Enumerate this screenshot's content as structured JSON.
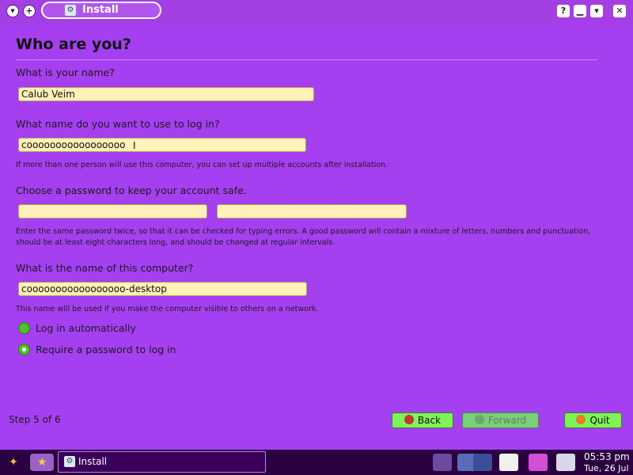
{
  "window": {
    "title": "Install"
  },
  "page": {
    "heading": "Who are you?",
    "name_label": "What is your name?",
    "name_value": "Calub Veim",
    "login_label": "What name do you want to use to log in?",
    "login_value": "cooooooooooooooooo",
    "login_note": "If more than one person will use this computer, you can set up multiple accounts after installation.",
    "password_label": "Choose a password to keep your account safe.",
    "password_value": "",
    "password_confirm_value": "",
    "password_note_1": "Enter the same password twice, so that it can be checked for typing errors. A good password will contain a mixture of letters, numbers and punctuation,",
    "password_note_2": "should be at least eight characters long, and should be changed at regular intervals.",
    "computer_label": "What is the name of this computer?",
    "computer_value": "cooooooooooooooooo-desktop",
    "computer_note": "This name will be used if you make the computer visible to others on a network.",
    "options": [
      {
        "label": "Log in automatically",
        "selected": false
      },
      {
        "label": "Require a password to log in",
        "selected": true
      }
    ]
  },
  "footer": {
    "step": "Step 5 of 6",
    "back": "Back",
    "forward": "Forward",
    "quit": "Quit"
  },
  "taskbar": {
    "task_label": "Install",
    "time": "05:53 pm",
    "date": "Tue, 26 Jul"
  }
}
